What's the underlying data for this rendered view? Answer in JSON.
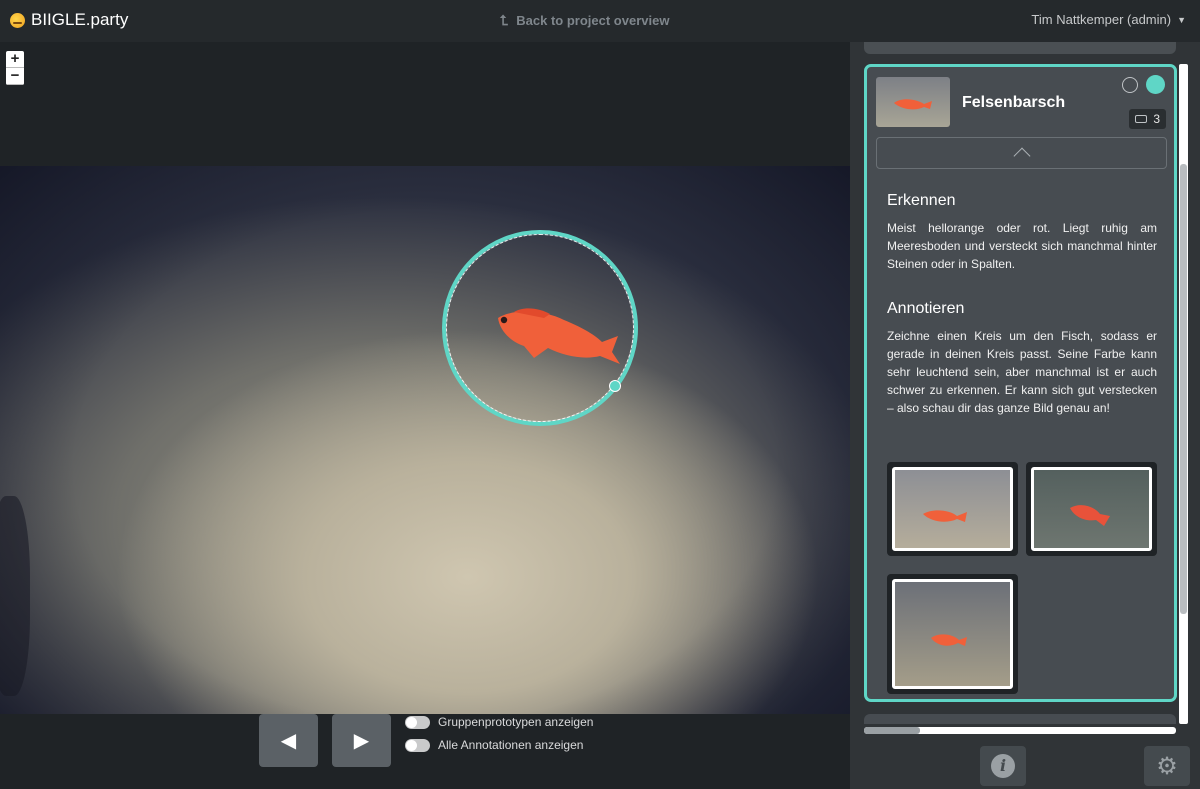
{
  "header": {
    "brand_name": "BIIGLE.party",
    "back_link": "Back to project overview",
    "user_menu": "Tim Nattkemper (admin)"
  },
  "viewer": {
    "zoom_in": "+",
    "zoom_out": "−",
    "toggles": [
      {
        "label": "Gruppenprototypen anzeigen",
        "on": false
      },
      {
        "label": "Alle Annotationen anzeigen",
        "on": false
      }
    ]
  },
  "card": {
    "title": "Felsenbarsch",
    "count": "3",
    "sections": [
      {
        "heading": "Erkennen",
        "text": "Meist hellorange oder rot. Liegt ruhig am Meeresboden und versteckt sich manchmal hinter Steinen oder in Spalten."
      },
      {
        "heading": "Annotieren",
        "text": "Zeichne einen Kreis um den Fisch, sodass er gerade in deinen Kreis passt. Seine Farbe kann sehr leuchtend sein, aber manchmal ist er auch schwer zu erkennen. Er kann sich gut verstecken – also schau dir das ganze Bild genau an!"
      }
    ]
  },
  "colors": {
    "accent": "#5fd6c6",
    "fish": "#f0603a",
    "sidebar_bg": "#303437",
    "card_bg": "#474c51"
  }
}
